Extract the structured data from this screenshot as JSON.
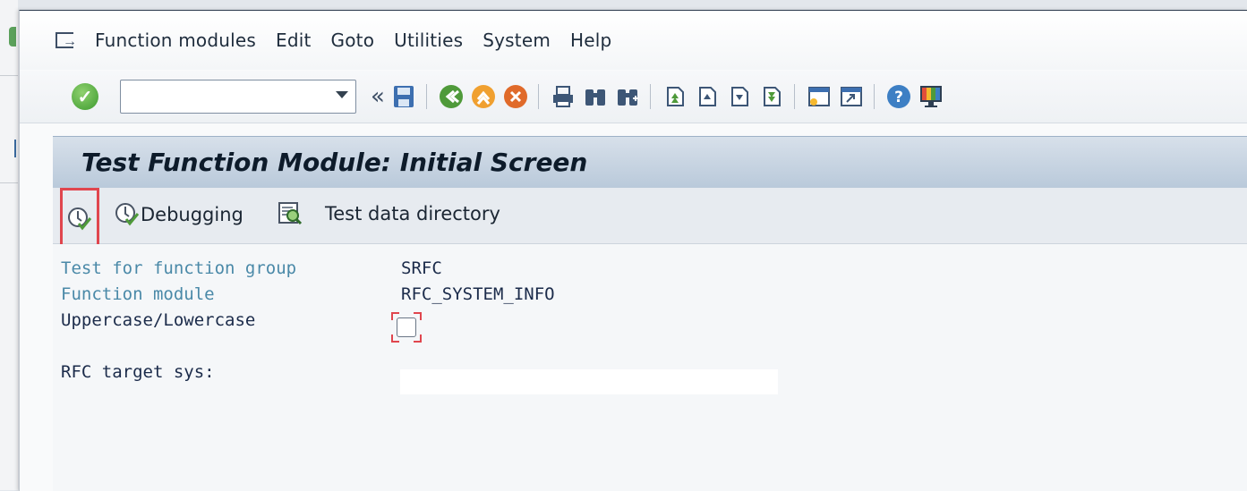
{
  "menubar": {
    "items": [
      {
        "key": "F",
        "rest": "unction modules"
      },
      {
        "key": "E",
        "rest": "dit"
      },
      {
        "key": "G",
        "rest": "oto"
      },
      {
        "key": "U",
        "rest": "tilities"
      },
      {
        "key": "S",
        "pre": "S",
        "keymid": "y",
        "rest": "stem"
      },
      {
        "key": "H",
        "rest": "elp"
      }
    ],
    "labels": [
      "Function modules",
      "Edit",
      "Goto",
      "Utilities",
      "System",
      "Help"
    ]
  },
  "toolbar": {
    "command_field_value": "",
    "back_symbol": "«"
  },
  "screen": {
    "title": "Test Function Module: Initial Screen"
  },
  "app_toolbar": {
    "debugging_label": "Debugging",
    "test_data_directory_label": "Test data directory"
  },
  "form": {
    "test_for_function_group_label": "Test for function group",
    "test_for_function_group_value": "SRFC",
    "function_module_label": "Function module",
    "function_module_value": "RFC_SYSTEM_INFO",
    "uppercase_lowercase_label": "Uppercase/Lowercase",
    "uppercase_lowercase_checked": false,
    "rfc_target_sys_label": "RFC target sys:",
    "rfc_target_sys_value": ""
  },
  "colors": {
    "highlight": "#e0464e",
    "title_band": "#c6d3e1",
    "label_blue": "#4a89a8",
    "label_dark": "#1b2b4a"
  },
  "icons": [
    "menu-icon",
    "ok-icon",
    "save-icon",
    "back-icon",
    "exit-icon",
    "cancel-icon",
    "print-icon",
    "find-icon",
    "find-next-icon",
    "first-page-icon",
    "previous-page-icon",
    "next-page-icon",
    "last-page-icon",
    "create-session-icon",
    "shortcut-icon",
    "help-icon",
    "layout-icon",
    "execute-icon",
    "debugging-icon",
    "test-data-directory-icon"
  ]
}
